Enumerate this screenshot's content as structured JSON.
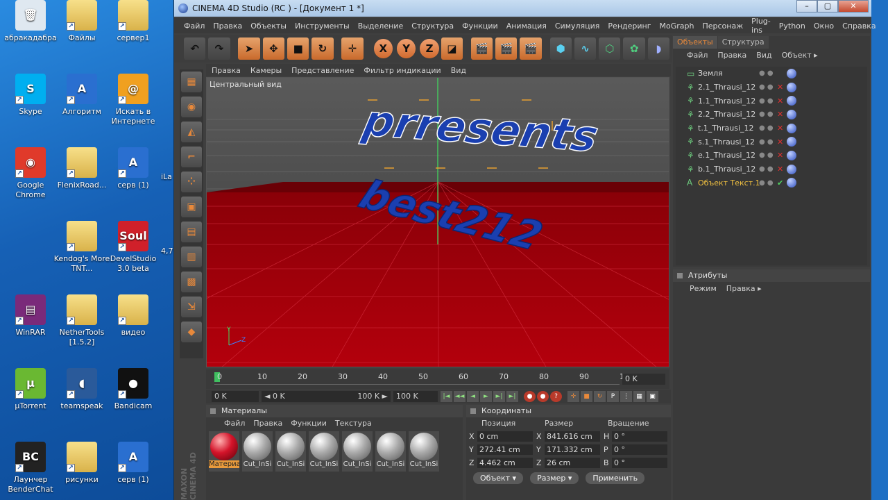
{
  "desktop": {
    "icons": [
      {
        "label": "абракадабра",
        "col": 0,
        "row": 0,
        "kind": "recycle"
      },
      {
        "label": "Файлы",
        "col": 1,
        "row": 0,
        "kind": "folder"
      },
      {
        "label": "сервер1",
        "col": 2,
        "row": 0,
        "kind": "folder"
      },
      {
        "label": "Skype",
        "col": 0,
        "row": 1,
        "kind": "skype"
      },
      {
        "label": "Алгоритм",
        "col": 1,
        "row": 1,
        "kind": "globe"
      },
      {
        "label": "Искать в Интернете",
        "col": 2,
        "row": 1,
        "kind": "search"
      },
      {
        "label": "Google Chrome",
        "col": 0,
        "row": 2,
        "kind": "chrome"
      },
      {
        "label": "FlenixRoad...",
        "col": 1,
        "row": 2,
        "kind": "folder"
      },
      {
        "label": "серв (1)",
        "col": 2,
        "row": 2,
        "kind": "globe"
      },
      {
        "label": "Kendog's More TNT...",
        "col": 1,
        "row": 3,
        "kind": "folder"
      },
      {
        "label": "DevelStudio 3.0 beta",
        "col": 2,
        "row": 3,
        "kind": "soul"
      },
      {
        "label": "WinRAR",
        "col": 0,
        "row": 4,
        "kind": "winrar"
      },
      {
        "label": "NetherTools [1.5.2]",
        "col": 1,
        "row": 4,
        "kind": "folder"
      },
      {
        "label": "видео",
        "col": 2,
        "row": 4,
        "kind": "folder"
      },
      {
        "label": "µTorrent",
        "col": 0,
        "row": 5,
        "kind": "utorrent"
      },
      {
        "label": "teamspeak",
        "col": 1,
        "row": 5,
        "kind": "teamspeak"
      },
      {
        "label": "Bandicam",
        "col": 2,
        "row": 5,
        "kind": "bandicam"
      },
      {
        "label": "Лаунчер BenderChat",
        "col": 0,
        "row": 6,
        "kind": "bc"
      },
      {
        "label": "рисунки",
        "col": 1,
        "row": 6,
        "kind": "folder"
      },
      {
        "label": "серв (1)",
        "col": 2,
        "row": 6,
        "kind": "globe"
      }
    ],
    "edge_labels": [
      "iLa",
      "4,7"
    ]
  },
  "window": {
    "title": "CINEMA 4D Studio (RC ) - [Документ 1 *]",
    "minimize": "–",
    "maximize": "▢",
    "close": "✕"
  },
  "menu": [
    "Файл",
    "Правка",
    "Объекты",
    "Инструменты",
    "Выделение",
    "Структура",
    "Функции",
    "Анимация",
    "Симуляция",
    "Рендеринг",
    "MoGraph",
    "Персонаж",
    "Plug-ins",
    "Python",
    "Окно",
    "Справка"
  ],
  "toolbar": {
    "undo": "↶",
    "redo": "↷",
    "x": "X",
    "y": "Y",
    "z": "Z"
  },
  "viewport": {
    "menu": [
      "Правка",
      "Камеры",
      "Представление",
      "Фильтр индикации",
      "Вид"
    ],
    "label": "Центральный вид",
    "text_top": "prresents",
    "text_bottom": "best212",
    "axis_y": "Y",
    "axis_z": "Z"
  },
  "timeline": {
    "ticks": [
      "0",
      "10",
      "20",
      "30",
      "40",
      "50",
      "60",
      "70",
      "80",
      "90",
      "100"
    ],
    "current_frame": "0 K",
    "start": "0 K",
    "range_start": "◄ 0 K",
    "range_end": "100 K ►",
    "end": "100 K"
  },
  "materials": {
    "title": "Материалы",
    "menu": [
      "Файл",
      "Правка",
      "Функции",
      "Текстура"
    ],
    "items": [
      {
        "name": "Материа",
        "red": true
      },
      {
        "name": "Cut_InSi",
        "red": false
      },
      {
        "name": "Cut_InSi",
        "red": false
      },
      {
        "name": "Cut_InSi",
        "red": false
      },
      {
        "name": "Cut_InSi",
        "red": false
      },
      {
        "name": "Cut_InSi",
        "red": false
      },
      {
        "name": "Cut_InSi",
        "red": false
      }
    ]
  },
  "coords": {
    "title": "Координаты",
    "headers": [
      "Позиция",
      "Размер",
      "Вращение"
    ],
    "rows": [
      {
        "a": "X",
        "pos": "0 cm",
        "b": "X",
        "size": "841.616 cm",
        "c": "H",
        "rot": "0 °"
      },
      {
        "a": "Y",
        "pos": "272.41 cm",
        "b": "Y",
        "size": "171.332 cm",
        "c": "P",
        "rot": "0 °"
      },
      {
        "a": "Z",
        "pos": "4.462 cm",
        "b": "Z",
        "size": "26 cm",
        "c": "B",
        "rot": "0 °"
      }
    ],
    "mode1": "Объект ▾",
    "mode2": "Размер ▾",
    "apply": "Применить"
  },
  "objects": {
    "tabs": [
      "Объекты",
      "Структура"
    ],
    "menu": [
      "Файл",
      "Правка",
      "Вид",
      "Объект ▸"
    ],
    "rows": [
      {
        "name": "Земля",
        "hl": false
      },
      {
        "name": "2.1_Thrausi_12",
        "hl": false
      },
      {
        "name": "1.1_Thrausi_12",
        "hl": false
      },
      {
        "name": "2.2_Thrausi_12",
        "hl": false
      },
      {
        "name": "t.1_Thrausi_12",
        "hl": false
      },
      {
        "name": "s.1_Thrausi_12",
        "hl": false
      },
      {
        "name": "e.1_Thrausi_12",
        "hl": false
      },
      {
        "name": "b.1_Thrausi_12",
        "hl": false
      },
      {
        "name": "Объект Текст.1",
        "hl": true
      }
    ]
  },
  "attributes": {
    "title": "Атрибуты",
    "menu": [
      "Режим",
      "Правка ▸"
    ]
  },
  "brand": "MAXON CINEMA 4D",
  "colors": {
    "accent": "#e8893b",
    "viewport_floor": "#b0000a",
    "text3d": "#1a3fb0"
  }
}
